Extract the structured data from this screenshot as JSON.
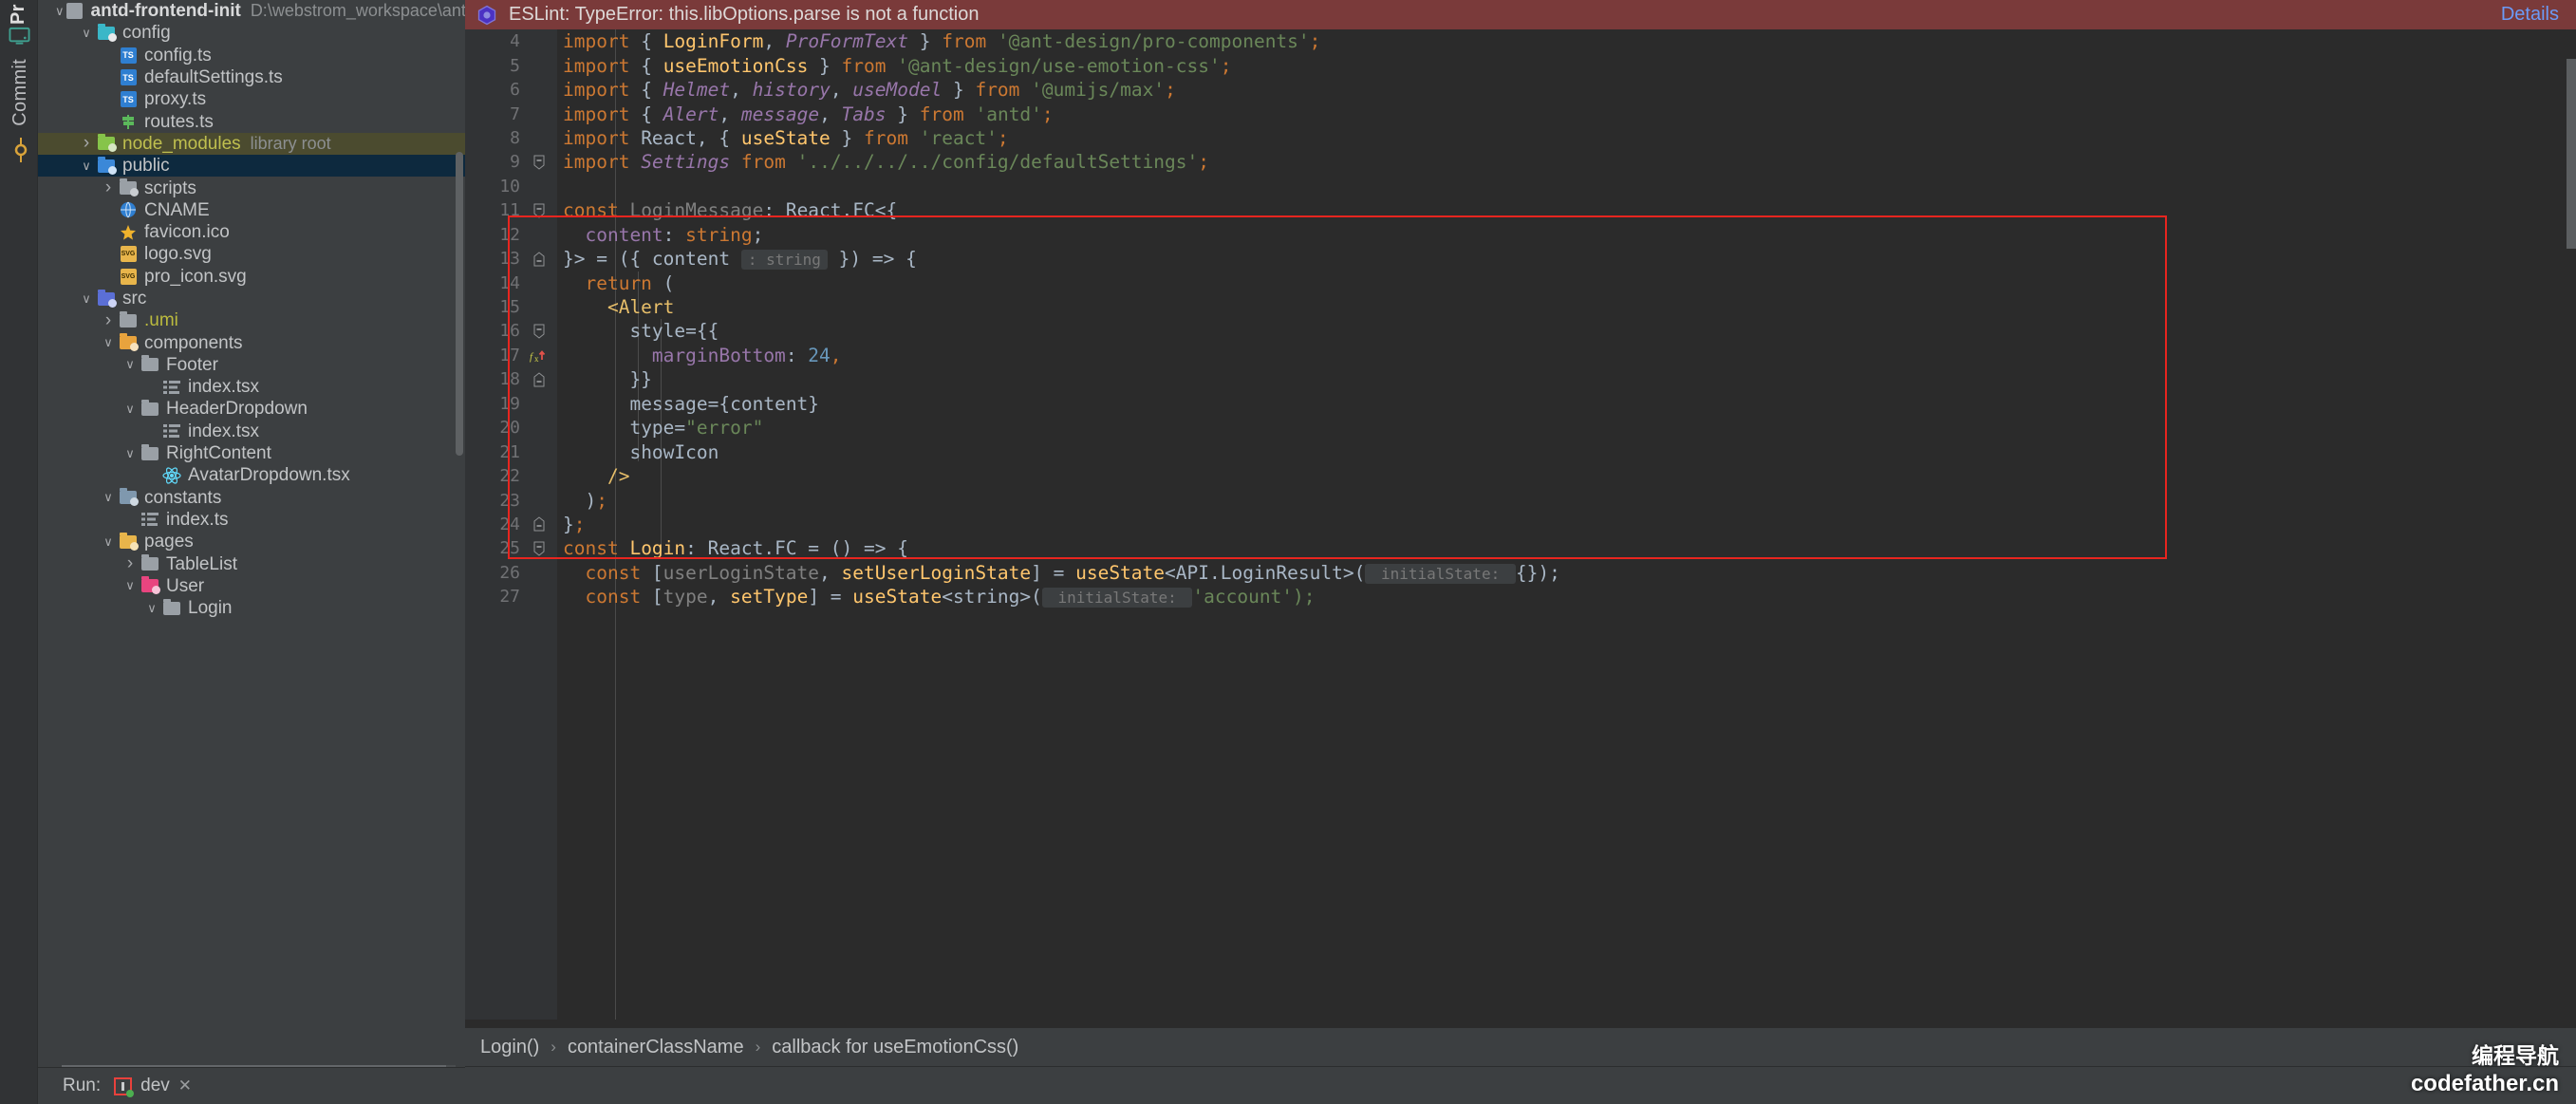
{
  "tool_rail": {
    "project_label": "Pr",
    "commit_label": "Commit",
    "icons": {
      "preview": "monitor-icon",
      "commit": "git-commit-icon"
    }
  },
  "project_tree": {
    "items": [
      {
        "depth": 0,
        "arrow": "down",
        "icon": "module-icon",
        "label": "antd-frontend-init",
        "bold": true,
        "hint": "D:\\webstrom_workspace\\antd-frontend-in"
      },
      {
        "depth": 1,
        "arrow": "down",
        "icon": "folder-config",
        "label": "config"
      },
      {
        "depth": 2,
        "arrow": "none",
        "icon": "ts-file",
        "label": "config.ts"
      },
      {
        "depth": 2,
        "arrow": "none",
        "icon": "ts-file",
        "label": "defaultSettings.ts"
      },
      {
        "depth": 2,
        "arrow": "none",
        "icon": "ts-file",
        "label": "proxy.ts"
      },
      {
        "depth": 2,
        "arrow": "none",
        "icon": "routes-icon",
        "label": "routes.ts"
      },
      {
        "depth": 1,
        "arrow": "right",
        "icon": "folder-node",
        "label": "node_modules",
        "hint": "library root",
        "style": "libroot"
      },
      {
        "depth": 1,
        "arrow": "down",
        "icon": "folder-public",
        "label": "public",
        "style": "selected"
      },
      {
        "depth": 2,
        "arrow": "right",
        "icon": "folder-scripts",
        "label": "scripts"
      },
      {
        "depth": 2,
        "arrow": "none",
        "icon": "globe-icon",
        "label": "CNAME"
      },
      {
        "depth": 2,
        "arrow": "none",
        "icon": "star-icon",
        "label": "favicon.ico"
      },
      {
        "depth": 2,
        "arrow": "none",
        "icon": "svg-file",
        "label": "logo.svg"
      },
      {
        "depth": 2,
        "arrow": "none",
        "icon": "svg-file",
        "label": "pro_icon.svg"
      },
      {
        "depth": 1,
        "arrow": "down",
        "icon": "folder-src",
        "label": "src"
      },
      {
        "depth": 2,
        "arrow": "right",
        "icon": "folder-plain",
        "label": ".umi",
        "style": "excluded"
      },
      {
        "depth": 2,
        "arrow": "down",
        "icon": "folder-components",
        "label": "components"
      },
      {
        "depth": 3,
        "arrow": "down",
        "icon": "folder-plain",
        "label": "Footer"
      },
      {
        "depth": 4,
        "arrow": "none",
        "icon": "tsx-list-icon",
        "label": "index.tsx"
      },
      {
        "depth": 3,
        "arrow": "down",
        "icon": "folder-plain",
        "label": "HeaderDropdown"
      },
      {
        "depth": 4,
        "arrow": "none",
        "icon": "tsx-list-icon",
        "label": "index.tsx"
      },
      {
        "depth": 3,
        "arrow": "down",
        "icon": "folder-plain",
        "label": "RightContent"
      },
      {
        "depth": 4,
        "arrow": "none",
        "icon": "react-icon",
        "label": "AvatarDropdown.tsx"
      },
      {
        "depth": 2,
        "arrow": "down",
        "icon": "folder-constants",
        "label": "constants"
      },
      {
        "depth": 3,
        "arrow": "none",
        "icon": "tsx-list-icon",
        "label": "index.ts"
      },
      {
        "depth": 2,
        "arrow": "down",
        "icon": "folder-pages",
        "label": "pages"
      },
      {
        "depth": 3,
        "arrow": "right",
        "icon": "folder-plain",
        "label": "TableList"
      },
      {
        "depth": 3,
        "arrow": "down",
        "icon": "folder-user",
        "label": "User"
      },
      {
        "depth": 4,
        "arrow": "down",
        "icon": "folder-plain",
        "label": "Login"
      }
    ]
  },
  "run_bar": {
    "label": "Run:",
    "tab": "dev",
    "close": "✕"
  },
  "eslint_bar": {
    "icon": "eslint-icon",
    "message": "ESLint: TypeError: this.libOptions.parse is not a function",
    "details_link": "Details"
  },
  "code": {
    "language": "tsx",
    "first_line_number": 4,
    "lines": [
      {
        "n": 4,
        "tokens": [
          {
            "t": "import",
            "c": "k"
          },
          {
            "t": " { ",
            "c": "id"
          },
          {
            "t": "LoginForm",
            "c": "fn"
          },
          {
            "t": ", ",
            "c": "id"
          },
          {
            "t": "ProFormText",
            "c": "ital"
          },
          {
            "t": " } ",
            "c": "id"
          },
          {
            "t": "from",
            "c": "k"
          },
          {
            "t": " ",
            "c": "id"
          },
          {
            "t": "'@ant-design/pro-components'",
            "c": "str"
          },
          {
            "t": ";",
            "c": "k"
          }
        ]
      },
      {
        "n": 5,
        "tokens": [
          {
            "t": "import",
            "c": "k"
          },
          {
            "t": " { ",
            "c": "id"
          },
          {
            "t": "useEmotionCss",
            "c": "fn"
          },
          {
            "t": " } ",
            "c": "id"
          },
          {
            "t": "from",
            "c": "k"
          },
          {
            "t": " ",
            "c": "id"
          },
          {
            "t": "'@ant-design/use-emotion-css'",
            "c": "str"
          },
          {
            "t": ";",
            "c": "k"
          }
        ]
      },
      {
        "n": 6,
        "tokens": [
          {
            "t": "import",
            "c": "k"
          },
          {
            "t": " { ",
            "c": "id"
          },
          {
            "t": "Helmet",
            "c": "ital"
          },
          {
            "t": ", ",
            "c": "id"
          },
          {
            "t": "history",
            "c": "ital"
          },
          {
            "t": ", ",
            "c": "id"
          },
          {
            "t": "useModel",
            "c": "ital"
          },
          {
            "t": " } ",
            "c": "id"
          },
          {
            "t": "from",
            "c": "k"
          },
          {
            "t": " ",
            "c": "id"
          },
          {
            "t": "'@umijs/max'",
            "c": "str"
          },
          {
            "t": ";",
            "c": "k"
          }
        ]
      },
      {
        "n": 7,
        "tokens": [
          {
            "t": "import",
            "c": "k"
          },
          {
            "t": " { ",
            "c": "id"
          },
          {
            "t": "Alert",
            "c": "ital"
          },
          {
            "t": ", ",
            "c": "id"
          },
          {
            "t": "message",
            "c": "ital"
          },
          {
            "t": ", ",
            "c": "id"
          },
          {
            "t": "Tabs",
            "c": "ital"
          },
          {
            "t": " } ",
            "c": "id"
          },
          {
            "t": "from",
            "c": "k"
          },
          {
            "t": " ",
            "c": "id"
          },
          {
            "t": "'antd'",
            "c": "str"
          },
          {
            "t": ";",
            "c": "k"
          }
        ]
      },
      {
        "n": 8,
        "tokens": [
          {
            "t": "import",
            "c": "k"
          },
          {
            "t": " React, { ",
            "c": "id"
          },
          {
            "t": "useState",
            "c": "fn"
          },
          {
            "t": " } ",
            "c": "id"
          },
          {
            "t": "from",
            "c": "k"
          },
          {
            "t": " ",
            "c": "id"
          },
          {
            "t": "'react'",
            "c": "str"
          },
          {
            "t": ";",
            "c": "k"
          }
        ]
      },
      {
        "n": 9,
        "fold": "top",
        "tokens": [
          {
            "t": "import",
            "c": "k"
          },
          {
            "t": " ",
            "c": "id"
          },
          {
            "t": "Settings",
            "c": "ital"
          },
          {
            "t": " ",
            "c": "id"
          },
          {
            "t": "from",
            "c": "k"
          },
          {
            "t": " ",
            "c": "id"
          },
          {
            "t": "'../../../../config/defaultSettings'",
            "c": "str"
          },
          {
            "t": ";",
            "c": "k"
          }
        ]
      },
      {
        "n": 10,
        "tokens": []
      },
      {
        "n": 11,
        "fold": "top",
        "tokens": [
          {
            "t": "const",
            "c": "k"
          },
          {
            "t": " ",
            "c": "id"
          },
          {
            "t": "LoginMessage",
            "c": "dim"
          },
          {
            "t": ": ",
            "c": "id"
          },
          {
            "t": "React.FC",
            "c": "id"
          },
          {
            "t": "<{",
            "c": "id"
          }
        ]
      },
      {
        "n": 12,
        "tokens": [
          {
            "t": "  ",
            "c": "id"
          },
          {
            "t": "content",
            "c": "pur"
          },
          {
            "t": ": ",
            "c": "id"
          },
          {
            "t": "string",
            "c": "k"
          },
          {
            "t": ";",
            "c": "id"
          }
        ]
      },
      {
        "n": 13,
        "fold": "bot",
        "tokens": [
          {
            "t": "}> = ({ ",
            "c": "id"
          },
          {
            "t": "content",
            "c": "id"
          },
          {
            "t": " ",
            "c": "id"
          },
          {
            "t": ": string",
            "c": "chip"
          },
          {
            "t": " }) => {",
            "c": "id"
          }
        ]
      },
      {
        "n": 14,
        "tokens": [
          {
            "t": "  ",
            "c": "id"
          },
          {
            "t": "return",
            "c": "k"
          },
          {
            "t": " (",
            "c": "id"
          }
        ]
      },
      {
        "n": 15,
        "tokens": [
          {
            "t": "    <",
            "c": "tag"
          },
          {
            "t": "Alert",
            "c": "tag"
          }
        ]
      },
      {
        "n": 16,
        "fold": "top",
        "tokens": [
          {
            "t": "      ",
            "c": "id"
          },
          {
            "t": "style",
            "c": "attr"
          },
          {
            "t": "={{",
            "c": "id"
          }
        ]
      },
      {
        "n": 17,
        "marker": "fx-error",
        "tokens": [
          {
            "t": "        ",
            "c": "id"
          },
          {
            "t": "marginBottom",
            "c": "pur"
          },
          {
            "t": ": ",
            "c": "id"
          },
          {
            "t": "24",
            "c": "num"
          },
          {
            "t": ",",
            "c": "k"
          }
        ]
      },
      {
        "n": 18,
        "fold": "bot",
        "tokens": [
          {
            "t": "      }}",
            "c": "id"
          }
        ]
      },
      {
        "n": 19,
        "tokens": [
          {
            "t": "      ",
            "c": "id"
          },
          {
            "t": "message",
            "c": "attr"
          },
          {
            "t": "={content}",
            "c": "id"
          }
        ]
      },
      {
        "n": 20,
        "tokens": [
          {
            "t": "      ",
            "c": "id"
          },
          {
            "t": "type",
            "c": "attr"
          },
          {
            "t": "=",
            "c": "id"
          },
          {
            "t": "\"error\"",
            "c": "str"
          }
        ]
      },
      {
        "n": 21,
        "tokens": [
          {
            "t": "      ",
            "c": "id"
          },
          {
            "t": "showIcon",
            "c": "attr"
          }
        ]
      },
      {
        "n": 22,
        "tokens": [
          {
            "t": "    />",
            "c": "tag"
          }
        ]
      },
      {
        "n": 23,
        "tokens": [
          {
            "t": "  )",
            "c": "id"
          },
          {
            "t": ";",
            "c": "k"
          }
        ]
      },
      {
        "n": 24,
        "fold": "bot",
        "tokens": [
          {
            "t": "}",
            "c": "id"
          },
          {
            "t": ";",
            "c": "k"
          }
        ]
      },
      {
        "n": 25,
        "fold": "top",
        "tokens": [
          {
            "t": "const",
            "c": "k"
          },
          {
            "t": " ",
            "c": "id"
          },
          {
            "t": "Login",
            "c": "fn"
          },
          {
            "t": ": ",
            "c": "id"
          },
          {
            "t": "React.FC",
            "c": "id"
          },
          {
            "t": " = () => {",
            "c": "id"
          }
        ]
      },
      {
        "n": 26,
        "tokens": [
          {
            "t": "  ",
            "c": "id"
          },
          {
            "t": "const",
            "c": "k"
          },
          {
            "t": " [",
            "c": "id"
          },
          {
            "t": "userLoginState",
            "c": "dim"
          },
          {
            "t": ", ",
            "c": "id"
          },
          {
            "t": "setUserLoginState",
            "c": "fn"
          },
          {
            "t": "] = ",
            "c": "id"
          },
          {
            "t": "useState",
            "c": "fn"
          },
          {
            "t": "<API.LoginResult>(",
            "c": "id"
          },
          {
            "t": " initialState: ",
            "c": "chip"
          },
          {
            "t": "{});",
            "c": "id"
          }
        ]
      },
      {
        "n": 27,
        "tokens": [
          {
            "t": "  ",
            "c": "id"
          },
          {
            "t": "const",
            "c": "k"
          },
          {
            "t": " [",
            "c": "id"
          },
          {
            "t": "type",
            "c": "dim"
          },
          {
            "t": ", ",
            "c": "id"
          },
          {
            "t": "setType",
            "c": "fn"
          },
          {
            "t": "] = ",
            "c": "id"
          },
          {
            "t": "useState",
            "c": "fn"
          },
          {
            "t": "<string>(",
            "c": "id"
          },
          {
            "t": " initialState: ",
            "c": "chip"
          },
          {
            "t": "'account');",
            "c": "str"
          }
        ]
      }
    ],
    "highlight_rect": {
      "from_line": 11,
      "to_line": 24,
      "color": "#e8251f"
    }
  },
  "breadcrumb": {
    "items": [
      "Login()",
      "containerClassName",
      "callback for useEmotionCss()"
    ],
    "separator": "›"
  },
  "watermark": {
    "cn": "编程导航",
    "url": "codefather.cn"
  },
  "colors": {
    "accent_error": "#e8251f",
    "eslint_bar_bg": "#7a3a3a",
    "editor_bg": "#2b2b2b",
    "panel_bg": "#3c3f41",
    "selection_bg": "#0d293e",
    "libroot_bg": "#4b4b2f",
    "link": "#6b9bf7"
  }
}
